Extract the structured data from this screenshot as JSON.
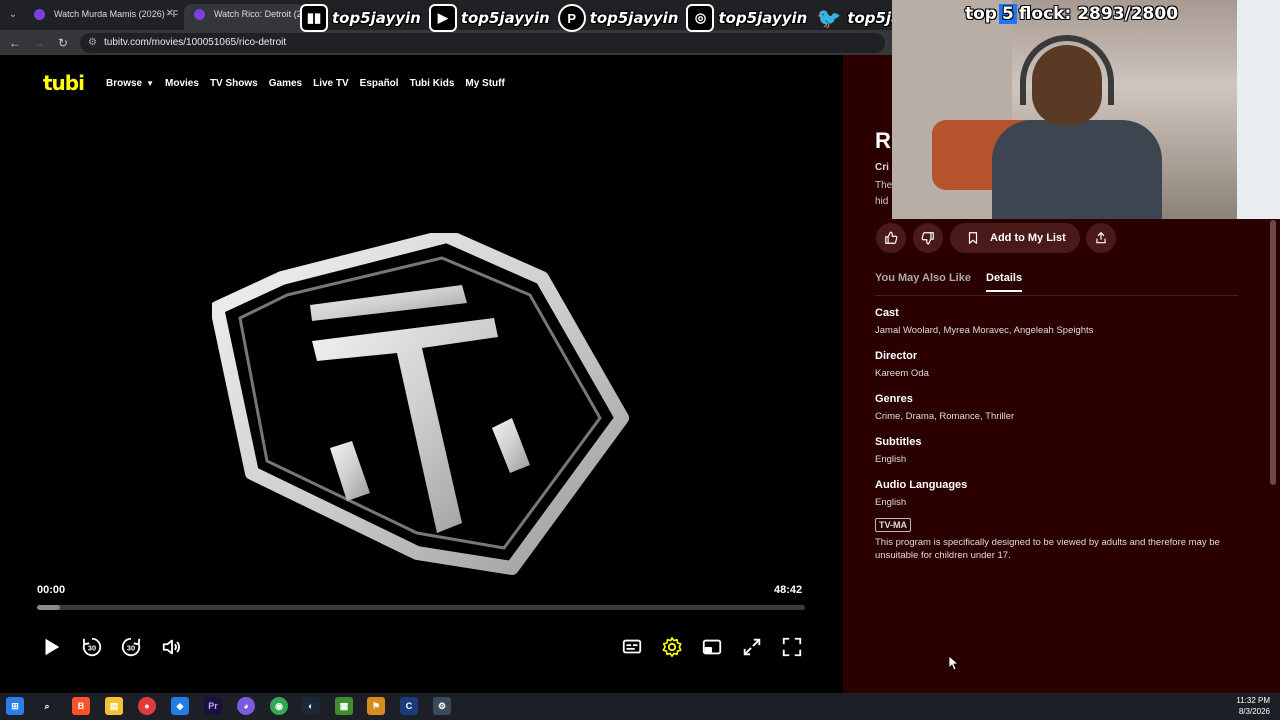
{
  "browser": {
    "tabs": [
      {
        "label": "Watch Murda Mamis (2026) - F"
      },
      {
        "label": "Watch Rico: Detroit (2025)"
      }
    ],
    "url": "tubitv.com/movies/100051065/rico-detroit"
  },
  "overlay": {
    "socials": [
      {
        "icon": "twitch-icon",
        "handle": "top5jayyin"
      },
      {
        "icon": "youtube-icon",
        "handle": "top5jayyin"
      },
      {
        "icon": "patreon-icon",
        "handle": "top5jayyin"
      },
      {
        "icon": "instagram-icon",
        "handle": "top5jayyin"
      },
      {
        "icon": "twitter-icon",
        "handle": "top5jayyin"
      }
    ],
    "flock_prefix": "top",
    "flock_num": "5",
    "flock_text": "flock: 2893/2800"
  },
  "nav": {
    "logo": "tubi",
    "links": [
      "Browse",
      "Movies",
      "TV Shows",
      "Games",
      "Live TV",
      "Español",
      "Tubi Kids",
      "My Stuff"
    ]
  },
  "player": {
    "time_current": "00:00",
    "time_total": "48:42",
    "progress": 0.03,
    "skip_back": "30",
    "skip_forward": "30"
  },
  "details": {
    "title_partial": "Ri",
    "genre_partial": "Cri",
    "desc_partial_1": "The",
    "desc_partial_2": "hid",
    "add_to_list": "Add to My List",
    "tabs": [
      "You May Also Like",
      "Details"
    ],
    "cast_label": "Cast",
    "cast": "Jamal Woolard, Myrea Moravec, Angeleah Speights",
    "director_label": "Director",
    "director": "Kareem Oda",
    "genres_label": "Genres",
    "genres": "Crime, Drama, Romance, Thriller",
    "subtitles_label": "Subtitles",
    "subtitles": "English",
    "audio_label": "Audio Languages",
    "audio": "English",
    "rating": "TV-MA",
    "rating_desc": "This program is specifically designed to be viewed by adults and therefore may be unsuitable for children under 17."
  },
  "taskbar": {
    "time": "11:32 PM",
    "date": "8/3/2026"
  },
  "colors": {
    "tubi_yellow": "#ffff13",
    "panel_bg": "#2b0000",
    "settings_gear": "#ffff13"
  }
}
